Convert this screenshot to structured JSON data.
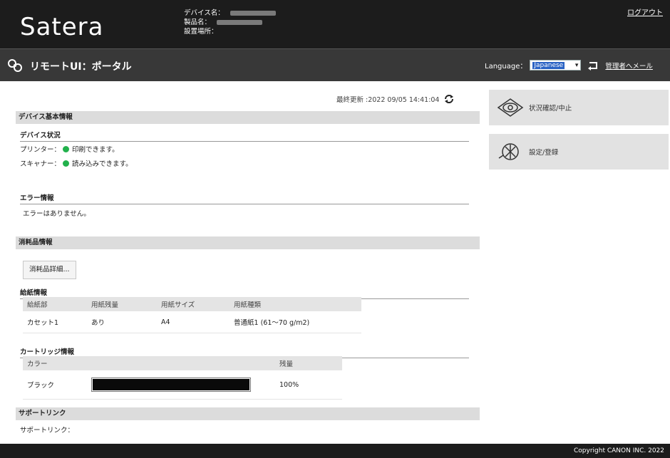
{
  "header": {
    "logo": "Satera",
    "device_name_label": "デバイス名：",
    "product_name_label": "製品名：",
    "location_label": "設置場所：",
    "logout": "ログアウト"
  },
  "titlebar": {
    "title": "リモートUI：ポータル",
    "language_label": "Language：",
    "language_value": "Japanese",
    "admin_mail": "管理者へメール"
  },
  "main": {
    "last_updated": "最終更新 :2022 09/05 14:41:04",
    "device_basic_info": "デバイス基本情報",
    "device_status": "デバイス状況",
    "printer_label": "プリンター：",
    "printer_status": "印刷できます。",
    "scanner_label": "スキャナー：",
    "scanner_status": "読み込みできます。",
    "error_info": "エラー情報",
    "error_message": "エラーはありません。",
    "consumables_info": "消耗品情報",
    "consumables_detail_button": "消耗品詳細...",
    "paper_info": "給紙情報",
    "tray_table": {
      "headers": [
        "給紙部",
        "用紙残量",
        "用紙サイズ",
        "用紙種類"
      ],
      "rows": [
        [
          "カセット1",
          "あり",
          "A4",
          "普通紙1 (61～70 g/m2)"
        ]
      ]
    },
    "cartridge_info": "カートリッジ情報",
    "cartridge_table": {
      "headers": [
        "カラー",
        "",
        "残量"
      ],
      "rows": [
        {
          "color": "ブラック",
          "level": 1.0,
          "level_text": "100%"
        }
      ]
    },
    "support_links": "サポートリンク",
    "support_link_label": "サポートリンク："
  },
  "sidebar": {
    "status_monitor": "状況確認/中止",
    "settings_register": "設定/登録"
  },
  "footer": {
    "copyright": "Copyright CANON INC. 2022"
  }
}
